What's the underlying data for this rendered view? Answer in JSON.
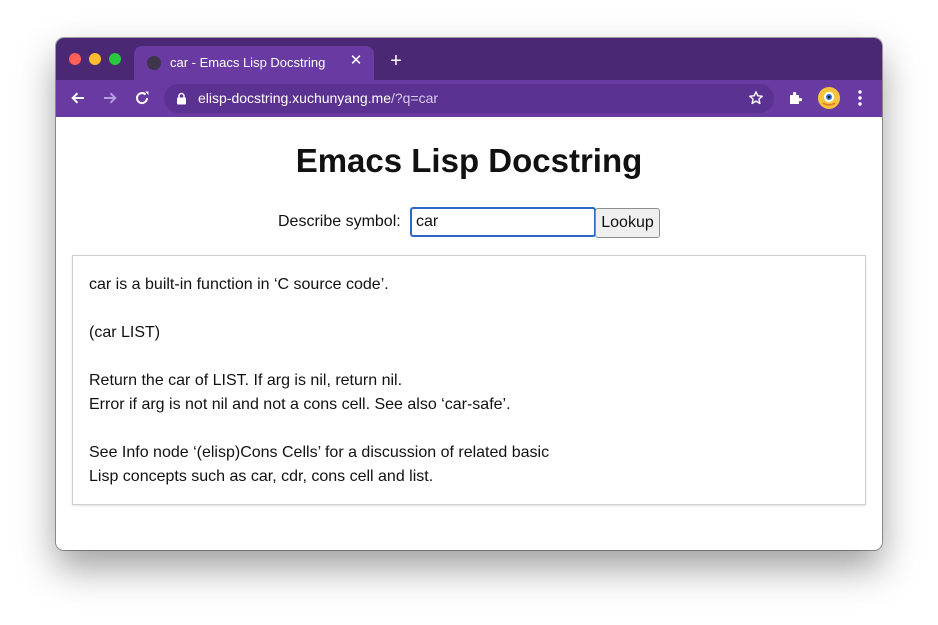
{
  "browser": {
    "tab": {
      "title": "car - Emacs Lisp Docstring",
      "close_label": "✕",
      "favicon_icon": "globe-icon"
    },
    "new_tab_label": "+",
    "address": {
      "host": "elisp-docstring.xuchunyang.me",
      "path": "/?q=car"
    },
    "colors": {
      "tabstrip": "#4a2874",
      "toolbar": "#6a3aa3"
    }
  },
  "page": {
    "title": "Emacs Lisp Docstring",
    "search": {
      "label": "Describe symbol:",
      "value": "car",
      "button_label": "Lookup"
    },
    "doc": {
      "lines": [
        "car is a built-in function in ‘C source code’.",
        "(car LIST)",
        "Return the car of LIST.  If arg is nil, return nil.",
        "Error if arg is not nil and not a cons cell.  See also ‘car-safe’.",
        "See Info node ‘(elisp)Cons Cells’ for a discussion of related basic",
        "Lisp concepts such as car, cdr, cons cell and list."
      ]
    }
  }
}
